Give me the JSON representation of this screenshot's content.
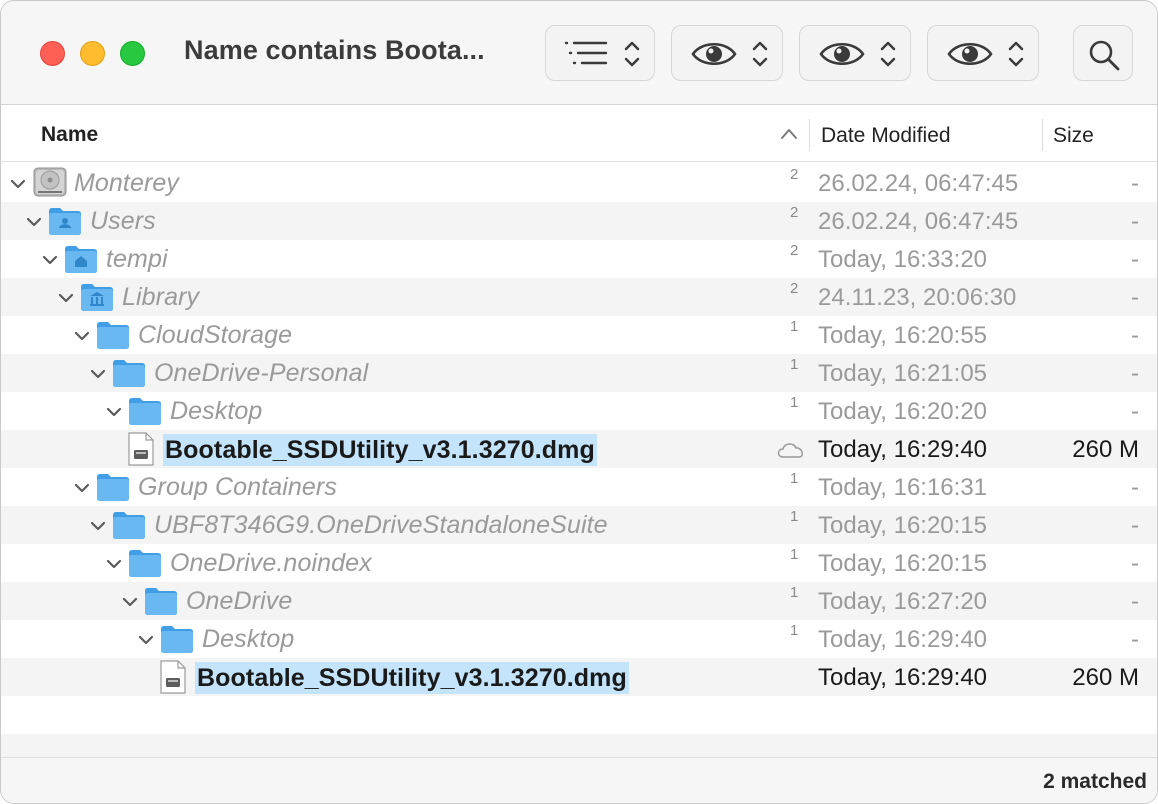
{
  "window": {
    "title": "Name contains Boota..."
  },
  "toolbar": {
    "view_button_icon": "list-view-icon",
    "quicklook_icon": "eye-icon",
    "search_icon": "search-icon"
  },
  "columns": {
    "name": "Name",
    "date_modified": "Date Modified",
    "size": "Size"
  },
  "rows": [
    {
      "name": "Monterey",
      "kind": "disk",
      "level": 0,
      "count": "2",
      "date": "26.02.24, 06:47:45",
      "size": "-",
      "hit": false
    },
    {
      "name": "Users",
      "kind": "users-folder",
      "level": 1,
      "count": "2",
      "date": "26.02.24, 06:47:45",
      "size": "-",
      "hit": false
    },
    {
      "name": "tempi",
      "kind": "home-folder",
      "level": 2,
      "count": "2",
      "date": "Today, 16:33:20",
      "size": "-",
      "hit": false
    },
    {
      "name": "Library",
      "kind": "library-folder",
      "level": 3,
      "count": "2",
      "date": "24.11.23, 20:06:30",
      "size": "-",
      "hit": false
    },
    {
      "name": "CloudStorage",
      "kind": "folder",
      "level": 4,
      "count": "1",
      "date": "Today, 16:20:55",
      "size": "-",
      "hit": false
    },
    {
      "name": "OneDrive-Personal",
      "kind": "folder",
      "level": 5,
      "count": "1",
      "date": "Today, 16:21:05",
      "size": "-",
      "hit": false
    },
    {
      "name": "Desktop",
      "kind": "folder",
      "level": 6,
      "count": "1",
      "date": "Today, 16:20:20",
      "size": "-",
      "hit": false
    },
    {
      "name": "Bootable_SSDUtility_v3.1.3270.dmg",
      "kind": "dmg",
      "level": 7,
      "count": "",
      "cloud": true,
      "date": "Today, 16:29:40",
      "size": "260 M",
      "hit": true
    },
    {
      "name": "Group Containers",
      "kind": "folder",
      "level": 4,
      "count": "1",
      "date": "Today, 16:16:31",
      "size": "-",
      "hit": false
    },
    {
      "name": "UBF8T346G9.OneDriveStandaloneSuite",
      "kind": "folder",
      "level": 5,
      "count": "1",
      "date": "Today, 16:20:15",
      "size": "-",
      "hit": false
    },
    {
      "name": "OneDrive.noindex",
      "kind": "folder",
      "level": 6,
      "count": "1",
      "date": "Today, 16:20:15",
      "size": "-",
      "hit": false
    },
    {
      "name": "OneDrive",
      "kind": "folder",
      "level": 7,
      "count": "1",
      "date": "Today, 16:27:20",
      "size": "-",
      "hit": false
    },
    {
      "name": "Desktop",
      "kind": "folder",
      "level": 8,
      "count": "1",
      "date": "Today, 16:29:40",
      "size": "-",
      "hit": false
    },
    {
      "name": "Bootable_SSDUtility_v3.1.3270.dmg",
      "kind": "dmg",
      "level": 9,
      "count": "",
      "cloud": false,
      "date": "Today, 16:29:40",
      "size": "260 M",
      "hit": true
    }
  ],
  "status": {
    "matched": "2 matched"
  }
}
